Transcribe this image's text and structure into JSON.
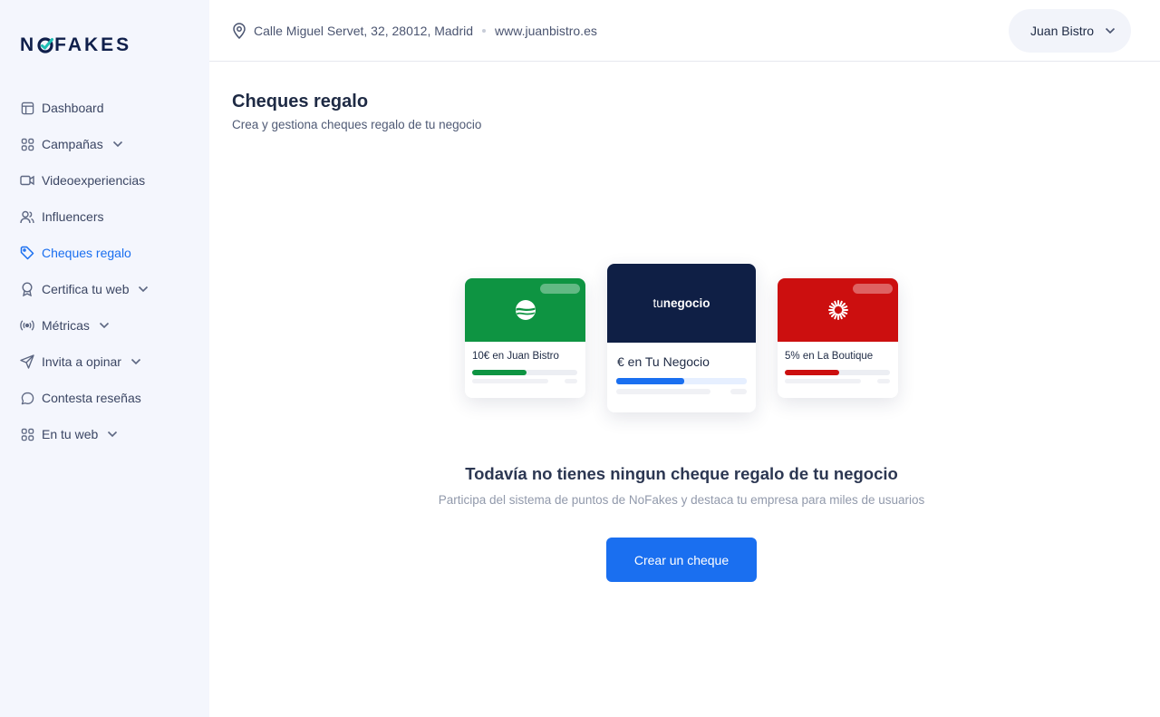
{
  "brand": {
    "logo_left": "N",
    "logo_right": "FAKES"
  },
  "sidebar": {
    "items": [
      {
        "label": "Dashboard",
        "icon": "layout-icon",
        "has_chevron": false,
        "active": false
      },
      {
        "label": "Campañas",
        "icon": "grid-icon",
        "has_chevron": true,
        "active": false
      },
      {
        "label": "Videoexperiencias",
        "icon": "video-icon",
        "has_chevron": false,
        "active": false
      },
      {
        "label": "Influencers",
        "icon": "users-icon",
        "has_chevron": false,
        "active": false
      },
      {
        "label": "Cheques regalo",
        "icon": "tag-icon",
        "has_chevron": false,
        "active": true
      },
      {
        "label": "Certifica tu web",
        "icon": "award-icon",
        "has_chevron": true,
        "active": false
      },
      {
        "label": "Métricas",
        "icon": "broadcast-icon",
        "has_chevron": true,
        "active": false
      },
      {
        "label": "Invita a opinar",
        "icon": "send-icon",
        "has_chevron": true,
        "active": false
      },
      {
        "label": "Contesta reseñas",
        "icon": "message-icon",
        "has_chevron": false,
        "active": false
      },
      {
        "label": "En tu web",
        "icon": "grid-icon",
        "has_chevron": true,
        "active": false
      }
    ]
  },
  "header": {
    "address": "Calle Miguel Servet, 32, 28012, Madrid",
    "website": "www.juanbistro.es",
    "user_name": "Juan Bistro"
  },
  "main": {
    "title": "Cheques regalo",
    "subtitle": "Crea y gestiona cheques regalo de tu negocio",
    "empty_title": "Todavía no tienes ningun cheque regalo de tu negocio",
    "empty_subtitle": "Participa del sistema de puntos de NoFakes y destaca tu empresa para miles de usuarios",
    "cta_label": "Crear un cheque"
  },
  "cards": [
    {
      "label": "10€ en Juan Bistro",
      "color": "#0e9442",
      "progress": 0.52
    },
    {
      "brand_prefix": "tu",
      "brand_name": "negocio",
      "label": "€ en Tu Negocio",
      "color": "#0f1f45",
      "progress": 0.52
    },
    {
      "label": "5% en La Boutique",
      "color": "#cc0f0f",
      "progress": 0.52
    }
  ],
  "colors": {
    "accent": "#1a6ff0",
    "sidebar_bg": "#f4f6fd",
    "brand_dark": "#0f1f4b",
    "check_green": "#1ec0b5"
  }
}
